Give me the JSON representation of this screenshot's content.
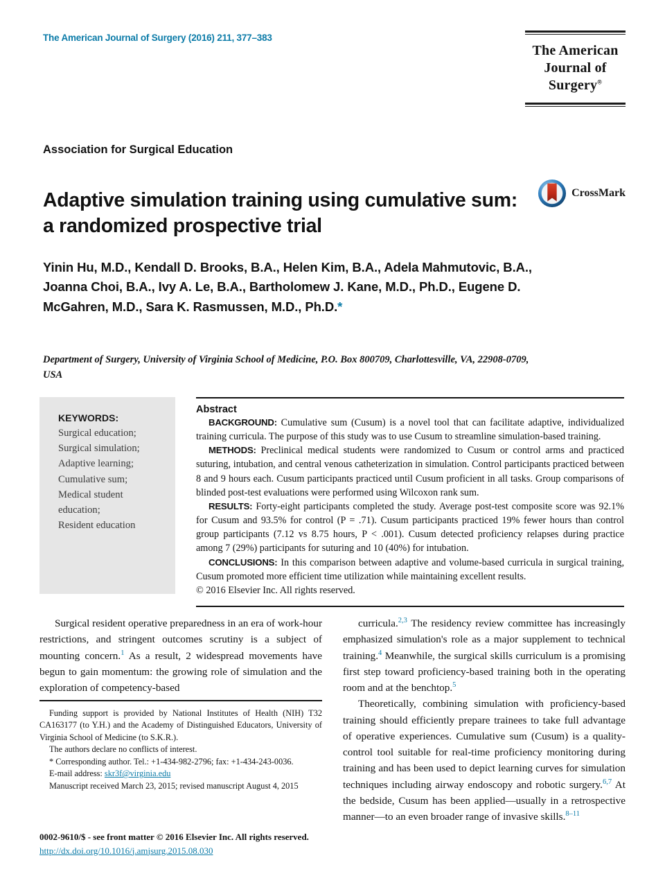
{
  "header": {
    "journal_reference": "The American Journal of Surgery (2016) 211, 377–383",
    "logo_line1": "The American",
    "logo_line2": "Journal of Surgery",
    "logo_mark": "®"
  },
  "article": {
    "society": "Association for Surgical Education",
    "title": "Adaptive simulation training using cumulative sum: a randomized prospective trial",
    "crossmark_label": "CrossMark",
    "authors": "Yinin Hu, M.D., Kendall D. Brooks, B.A., Helen Kim, B.A., Adela Mahmutovic, B.A., Joanna Choi, B.A., Ivy A. Le, B.A., Bartholomew J. Kane, M.D., Ph.D., Eugene D. McGahren, M.D., Sara K. Rasmussen, M.D., Ph.D.",
    "corresponding_marker": "*",
    "affiliation": "Department of Surgery, University of Virginia School of Medicine, P.O. Box 800709, Charlottesville, VA, 22908-0709, USA"
  },
  "keywords": {
    "title": "KEYWORDS:",
    "items": [
      "Surgical education;",
      "Surgical simulation;",
      "Adaptive learning;",
      "Cumulative sum;",
      "Medical student",
      "education;",
      "Resident education"
    ]
  },
  "abstract": {
    "heading": "Abstract",
    "sections": [
      {
        "label": "BACKGROUND:",
        "text": "Cumulative sum (Cusum) is a novel tool that can facilitate adaptive, individualized training curricula. The purpose of this study was to use Cusum to streamline simulation-based training."
      },
      {
        "label": "METHODS:",
        "text": "Preclinical medical students were randomized to Cusum or control arms and practiced suturing, intubation, and central venous catheterization in simulation. Control participants practiced between 8 and 9 hours each. Cusum participants practiced until Cusum proficient in all tasks. Group comparisons of blinded post-test evaluations were performed using Wilcoxon rank sum."
      },
      {
        "label": "RESULTS:",
        "text": "Forty-eight participants completed the study. Average post-test composite score was 92.1% for Cusum and 93.5% for control (P = .71). Cusum participants practiced 19% fewer hours than control group participants (7.12 vs 8.75 hours, P < .001). Cusum detected proficiency relapses during practice among 7 (29%) participants for suturing and 10 (40%) for intubation."
      },
      {
        "label": "CONCLUSIONS:",
        "text": "In this comparison between adaptive and volume-based curricula in surgical training, Cusum promoted more efficient time utilization while maintaining excellent results."
      }
    ],
    "copyright": "© 2016 Elsevier Inc. All rights reserved."
  },
  "body": {
    "left_column": [
      "Surgical resident operative preparedness in an era of work-hour restrictions, and stringent outcomes scrutiny is a subject of mounting concern.[1] As a result, 2 widespread movements have begun to gain momentum: the growing role of simulation and the exploration of competency-based"
    ],
    "right_column": [
      "curricula.[2,3] The residency review committee has increasingly emphasized simulation's role as a major supplement to technical training.[4] Meanwhile, the surgical skills curriculum is a promising first step toward proficiency-based training both in the operating room and at the benchtop.[5]",
      "Theoretically, combining simulation with proficiency-based training should efficiently prepare trainees to take full advantage of operative experiences. Cumulative sum (Cusum) is a quality-control tool suitable for real-time proficiency monitoring during training and has been used to depict learning curves for simulation techniques including airway endoscopy and robotic surgery.[6,7] At the bedside, Cusum has been applied—usually in a retrospective manner—to an even broader range of invasive skills.[8–11]"
    ]
  },
  "footnotes": {
    "funding": "Funding support is provided by National Institutes of Health (NIH) T32 CA163177 (to Y.H.) and the Academy of Distinguished Educators, University of Virginia School of Medicine (to S.K.R.).",
    "conflicts": "The authors declare no conflicts of interest.",
    "corresponding": "* Corresponding author. Tel.: +1-434-982-2796; fax: +1-434-243-0036.",
    "email_label": "E-mail address:",
    "email": "skr3f@virginia.edu",
    "manuscript": "Manuscript received March 23, 2015; revised manuscript August 4, 2015"
  },
  "footer": {
    "issn_line": "0002-9610/$ - see front matter © 2016 Elsevier Inc. All rights reserved.",
    "doi": "http://dx.doi.org/10.1016/j.amjsurg.2015.08.030"
  },
  "colors": {
    "link": "#0b7ba8",
    "keywords_background": "#e6e6e6",
    "text": "#111111"
  }
}
